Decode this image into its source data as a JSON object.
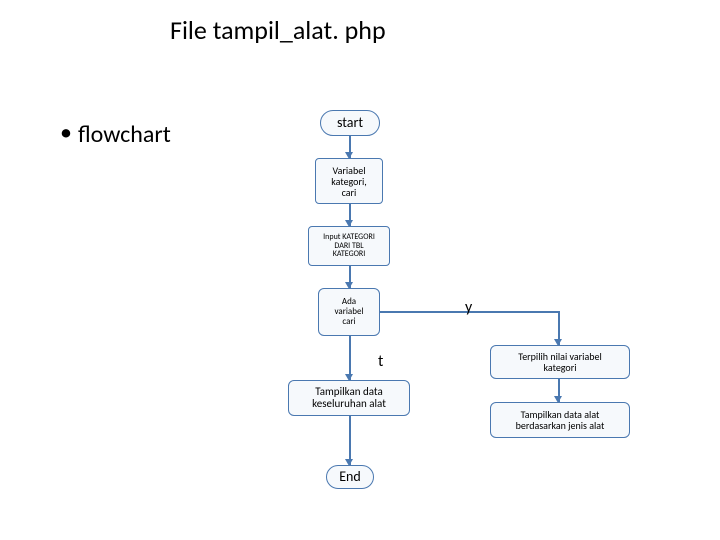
{
  "header": {
    "title": "File tampil_alat. php"
  },
  "bullet": {
    "text": "flowchart"
  },
  "nodes": {
    "start": "start",
    "vars": "Variabel\nkategori,\ncari",
    "input": "Input KATEGORI\nDARI TBL\nKATEGORI",
    "decision": "Ada\nvariabel\ncari",
    "show_all": "Tampilkan data\nkeseluruhan alat",
    "selected": "Terpilih nilai variabel\nkategori",
    "by_jenis": "Tampilkan data alat\nberdasarkan jenis alat",
    "end": "End"
  },
  "labels": {
    "yes": "y",
    "no": "t"
  }
}
